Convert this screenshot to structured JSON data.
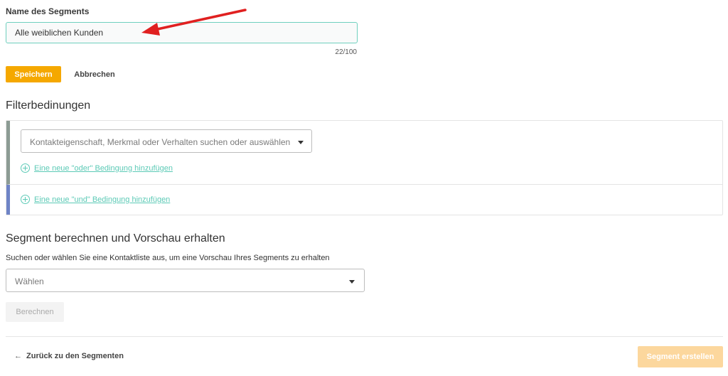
{
  "segment": {
    "name_label": "Name des Segments",
    "name_value": "Alle weiblichen Kunden",
    "char_count": "22/100"
  },
  "actions": {
    "save_label": "Speichern",
    "cancel_label": "Abbrechen"
  },
  "filters": {
    "heading": "Filterbedinungen",
    "property_placeholder": "Kontakteigenschaft, Merkmal oder Verhalten suchen oder auswählen",
    "add_or_label": "Eine neue \"oder\" Bedingung hinzufügen",
    "add_and_label": "Eine neue \"und\" Bedingung hinzufügen"
  },
  "preview": {
    "heading": "Segment berechnen und Vorschau erhalten",
    "description": "Suchen oder wählen Sie eine Kontaktliste aus, um eine Vorschau Ihres Segments zu erhalten",
    "select_value": "Wählen",
    "calculate_label": "Berechnen"
  },
  "footer": {
    "back_label": "Zurück zu den Segmenten",
    "back_icon": "arrow-left-icon",
    "create_label": "Segment erstellen"
  },
  "colors": {
    "accent_orange": "#f5a800",
    "accent_orange_disabled": "#fcd79d",
    "link_teal": "#5ccab6",
    "input_focus_border": "#6fd0be",
    "or_bar": "#8c9b94",
    "and_bar": "#6f84c6",
    "annotation_arrow": "#e02020"
  }
}
